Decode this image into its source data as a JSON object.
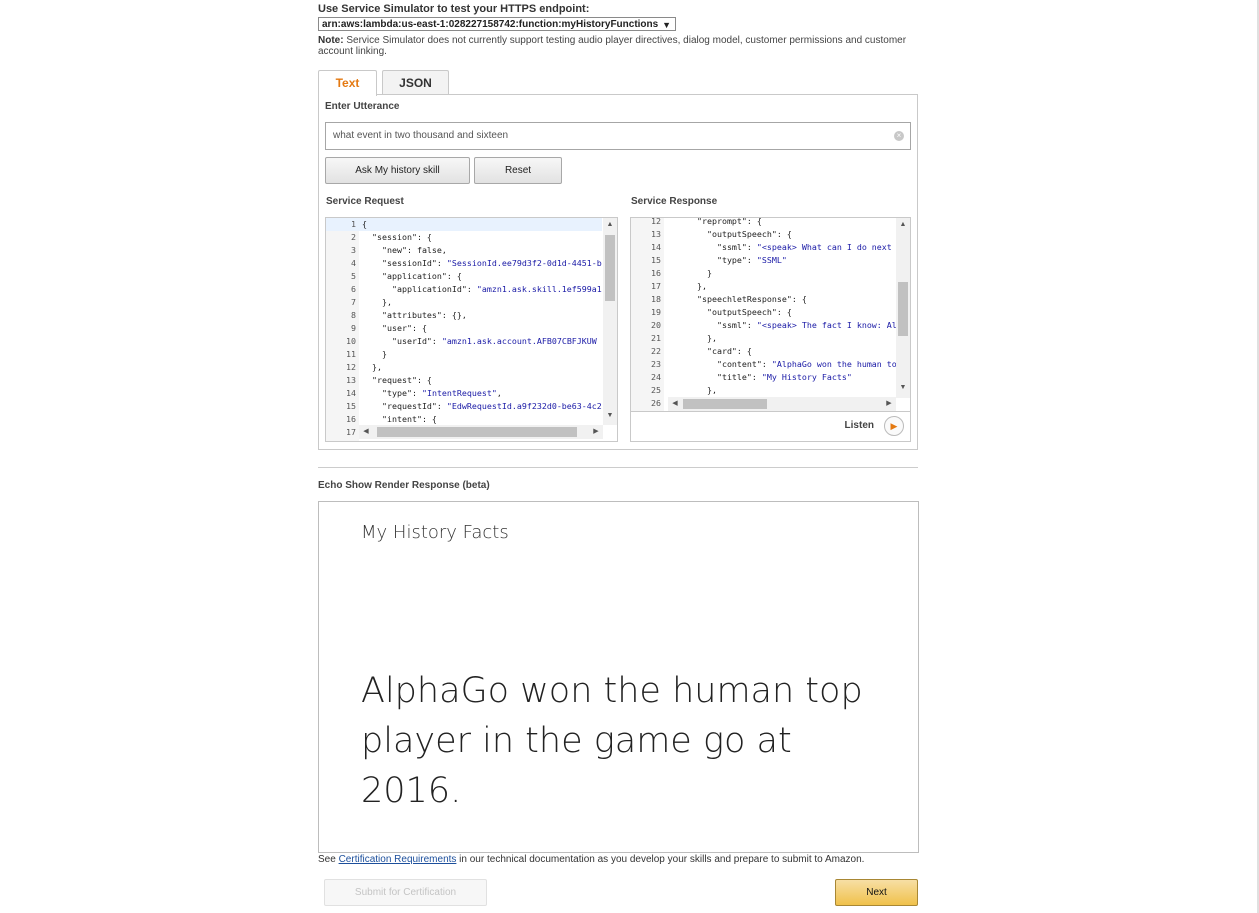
{
  "endpoint": {
    "label": "Use Service Simulator to test your HTTPS endpoint:",
    "selected": "arn:aws:lambda:us-east-1:028227158742:function:myHistoryFunctions",
    "arrow": "▼"
  },
  "note": {
    "bold": "Note:",
    "text": " Service Simulator does not currently support testing audio player directives, dialog model, customer permissions and customer account linking."
  },
  "tabs": [
    {
      "label": "Text",
      "active": true
    },
    {
      "label": "JSON",
      "active": false
    }
  ],
  "utterance": {
    "label": "Enter Utterance",
    "value": "what event in two thousand and sixteen"
  },
  "buttons": {
    "ask": "Ask My history skill",
    "reset": "Reset",
    "submit": "Submit for Certification",
    "next": "Next"
  },
  "service_request": {
    "label": "Service Request",
    "lines": [
      {
        "n": "1",
        "t": "{"
      },
      {
        "n": "2",
        "t": "  \"session\": {"
      },
      {
        "n": "3",
        "t": "    \"new\": false,"
      },
      {
        "n": "4",
        "t": "    \"sessionId\": \"SessionId.ee79d3f2-0d1d-4451-b"
      },
      {
        "n": "5",
        "t": "    \"application\": {"
      },
      {
        "n": "6",
        "t": "      \"applicationId\": \"amzn1.ask.skill.1ef599a1"
      },
      {
        "n": "7",
        "t": "    },"
      },
      {
        "n": "8",
        "t": "    \"attributes\": {},"
      },
      {
        "n": "9",
        "t": "    \"user\": {"
      },
      {
        "n": "10",
        "t": "      \"userId\": \"amzn1.ask.account.AFB07CBFJKUW"
      },
      {
        "n": "11",
        "t": "    }"
      },
      {
        "n": "12",
        "t": "  },"
      },
      {
        "n": "13",
        "t": "  \"request\": {"
      },
      {
        "n": "14",
        "t": "    \"type\": \"IntentRequest\","
      },
      {
        "n": "15",
        "t": "    \"requestId\": \"EdwRequestId.a9f232d0-be63-4c2"
      },
      {
        "n": "16",
        "t": "    \"intent\": {"
      },
      {
        "n": "17",
        "t": ""
      }
    ]
  },
  "service_response": {
    "label": "Service Response",
    "lines": [
      {
        "n": "12",
        "t": "      \"reprompt\": {"
      },
      {
        "n": "13",
        "t": "        \"outputSpeech\": {"
      },
      {
        "n": "14",
        "t": "          \"ssml\": \"<speak> What can I do next f"
      },
      {
        "n": "15",
        "t": "          \"type\": \"SSML\""
      },
      {
        "n": "16",
        "t": "        }"
      },
      {
        "n": "17",
        "t": "      },"
      },
      {
        "n": "18",
        "t": "      \"speechletResponse\": {"
      },
      {
        "n": "19",
        "t": "        \"outputSpeech\": {"
      },
      {
        "n": "20",
        "t": "          \"ssml\": \"<speak> The fact I know: Alp"
      },
      {
        "n": "21",
        "t": "        },"
      },
      {
        "n": "22",
        "t": "        \"card\": {"
      },
      {
        "n": "23",
        "t": "          \"content\": \"AlphaGo won the human top"
      },
      {
        "n": "24",
        "t": "          \"title\": \"My History Facts\""
      },
      {
        "n": "25",
        "t": "        },"
      },
      {
        "n": "26",
        "t": ""
      }
    ],
    "listen": "Listen"
  },
  "echo_show": {
    "label": "Echo Show Render Response (beta)",
    "title": "My History Facts",
    "content": "AlphaGo won the human top player in the game go at 2016."
  },
  "footer": {
    "see": "See ",
    "link": "Certification Requirements",
    "rest": " in our technical documentation as you develop your skills and prepare to submit to Amazon."
  },
  "icons": {
    "clear": "×",
    "play": "▶",
    "up": "▲",
    "down": "▼",
    "left": "◀",
    "right": "▶"
  },
  "colors": {
    "accent": "#e47911",
    "string": "#1a1aa6",
    "link": "#1c4f9c",
    "next_button": "#f0c14b"
  }
}
